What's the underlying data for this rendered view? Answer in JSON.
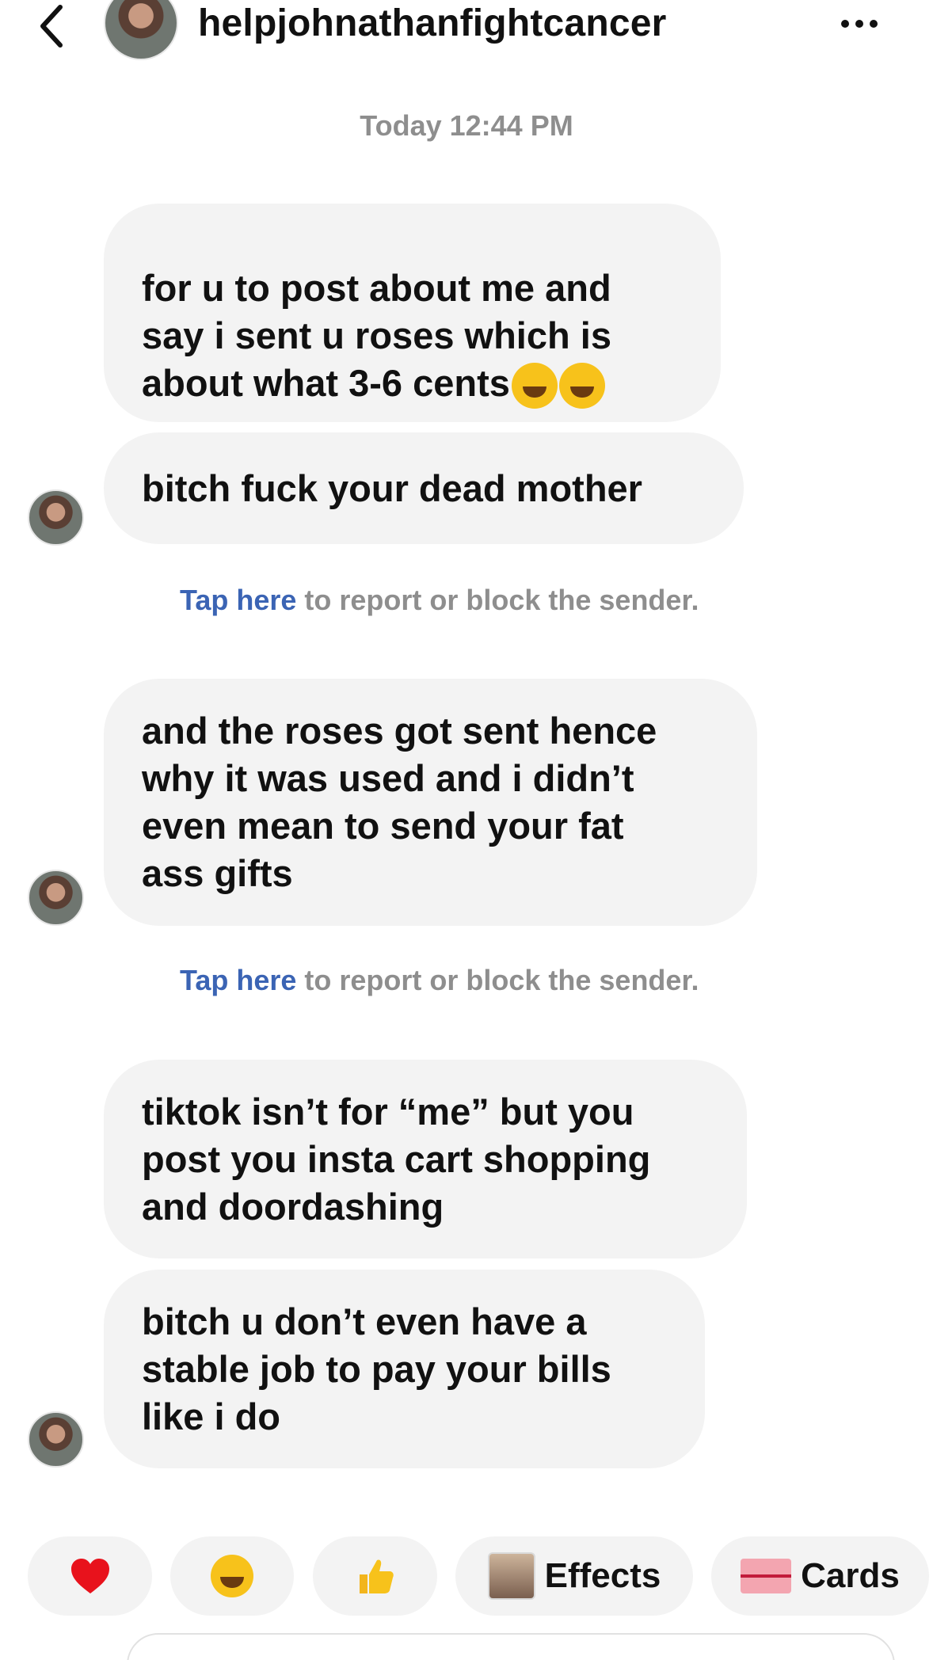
{
  "header": {
    "title": "helpjohnathanfightcancer",
    "back_icon": "chevron-left-icon",
    "more_icon": "more-horizontal-icon"
  },
  "timestamp": "Today 12:44 PM",
  "messages": [
    {
      "text": "for u to post about me and\nsay i sent u roses which is\nabout what 3-6 cents"
    },
    {
      "text": "bitch fuck your dead mother"
    },
    {
      "text": "and the roses got sent hence\nwhy it was used and i didn’t\neven mean to send your fat\nass gifts"
    },
    {
      "text": "tiktok isn’t for “me” but you\npost you insta cart shopping\nand doordashing"
    },
    {
      "text": "bitch u don’t even have a\nstable job to pay your bills\nlike i do"
    }
  ],
  "report": {
    "link_text": "Tap here",
    "rest_text": " to report or block the sender."
  },
  "quick_actions": {
    "heart": "heart-icon",
    "laugh": "laughing-face-icon",
    "thumbs": "thumbs-up-icon",
    "effects_label": "Effects",
    "cards_label": "Cards"
  },
  "colors": {
    "bubble": "#f3f3f3",
    "link": "#3b64b4",
    "meta_text": "#8e8e8e"
  }
}
